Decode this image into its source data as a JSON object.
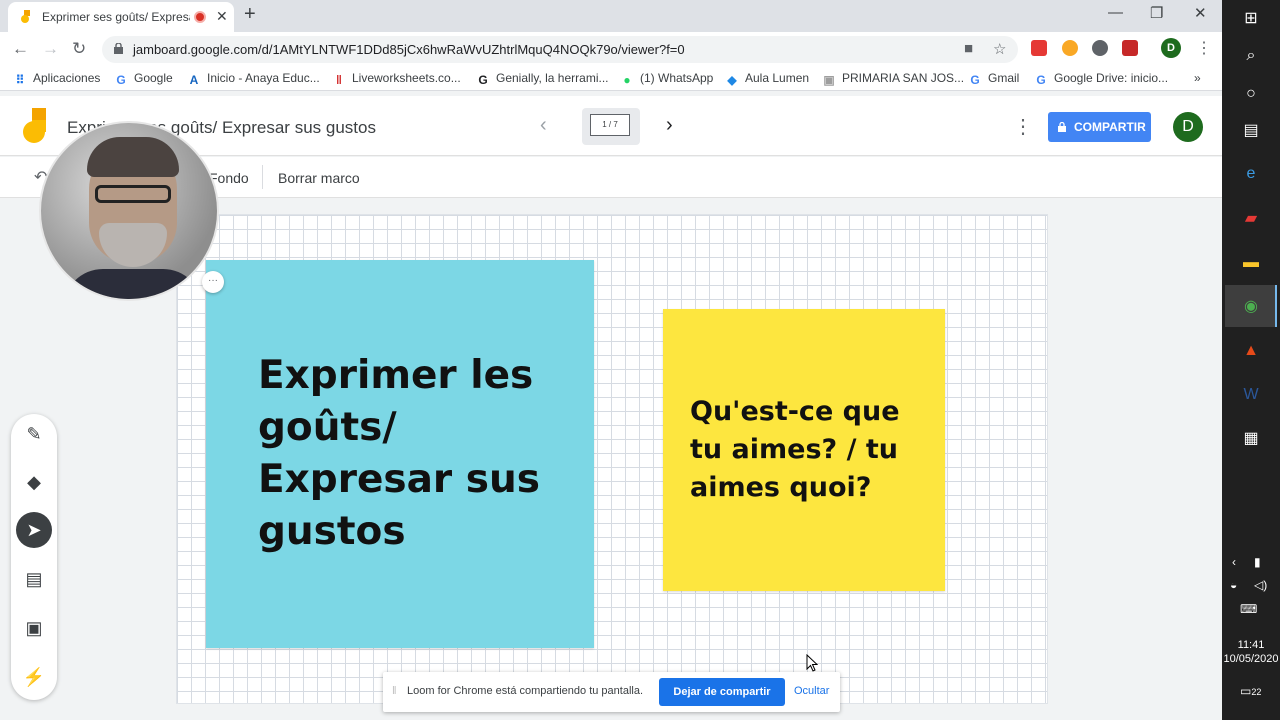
{
  "browser": {
    "tab_title": "Exprimer ses goûts/ Expresar",
    "url": "jamboard.google.com/d/1AMtYLNTWF1DDd85jCx6hwRaWvUZhtrlMquQ4NOQk79o/viewer?f=0",
    "profile_initial": "D",
    "bookmarks": [
      {
        "label": "Aplicaciones",
        "icon": "apps-grid-icon",
        "color": "#1a73e8"
      },
      {
        "label": "Google",
        "icon": "google-icon",
        "color": "#4285f4"
      },
      {
        "label": "Inicio - Anaya Educ...",
        "icon": "anaya-icon",
        "color": "#1565c0"
      },
      {
        "label": "Liveworksheets.co...",
        "icon": "liveworksheets-icon",
        "color": "#d32f2f"
      },
      {
        "label": "Genially, la herrami...",
        "icon": "genially-icon",
        "color": "#202124"
      },
      {
        "label": "(1) WhatsApp",
        "icon": "whatsapp-icon",
        "color": "#25d366"
      },
      {
        "label": "Aula Lumen",
        "icon": "lumen-icon",
        "color": "#1e88e5"
      },
      {
        "label": "PRIMARIA SAN JOS...",
        "icon": "school-icon",
        "color": "#9e9e9e"
      },
      {
        "label": "Gmail",
        "icon": "google-icon",
        "color": "#4285f4"
      },
      {
        "label": "Google Drive: inicio...",
        "icon": "google-icon",
        "color": "#4285f4"
      }
    ]
  },
  "app": {
    "title": "Exprimer ses goûts/ Expresar sus gustos",
    "frame_indicator": "1 / 7",
    "share_label": "COMPARTIR",
    "avatar_initial": "D",
    "toolbar": {
      "background_label": "Fondo",
      "clear_frame_label": "Borrar marco"
    },
    "more_chip": "···",
    "notes": {
      "blue_text": "Exprimer les goûts/ Expresar sus gustos",
      "yellow_text": "Qu'est-ce que tu aimes? / tu aimes quoi?"
    },
    "colors": {
      "blue_note": "#7cd7e5",
      "yellow_note": "#fde63f",
      "share_button": "#4285f4"
    }
  },
  "loom": {
    "message": "Loom for Chrome está compartiendo tu pantalla.",
    "stop_label": "Dejar de compartir",
    "hide_label": "Ocultar"
  },
  "taskbar": {
    "time": "11:41",
    "date": "10/05/2020",
    "notification_count": "22"
  }
}
